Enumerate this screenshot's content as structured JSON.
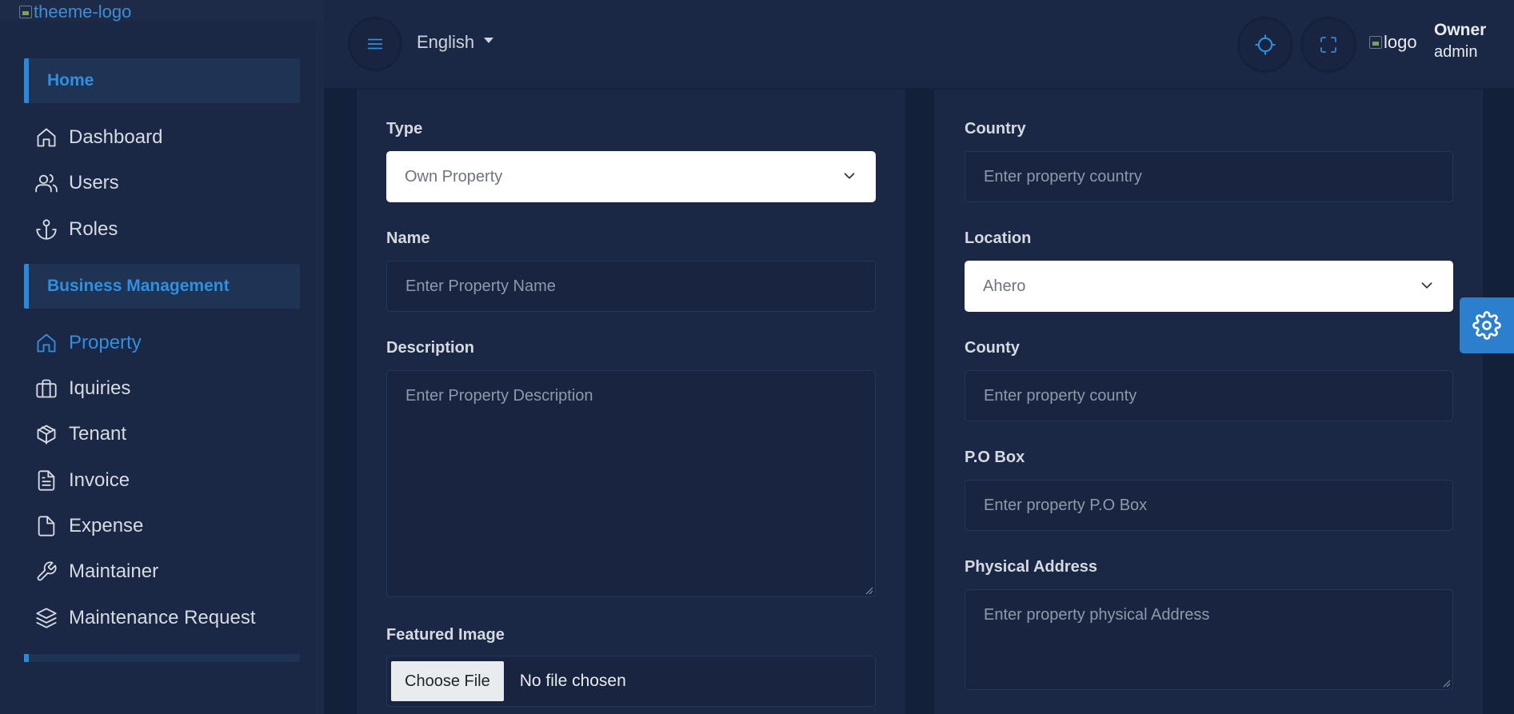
{
  "app": {
    "logo_alt": "theeme-logo"
  },
  "sidebar": {
    "sections": [
      {
        "label": "Home"
      },
      {
        "label": "Business Management"
      }
    ],
    "home_items": [
      {
        "label": "Dashboard",
        "icon": "home-icon"
      },
      {
        "label": "Users",
        "icon": "users-icon"
      },
      {
        "label": "Roles",
        "icon": "anchor-icon"
      }
    ],
    "business_items": [
      {
        "label": "Property",
        "icon": "home-icon",
        "active": true
      },
      {
        "label": "Iquiries",
        "icon": "briefcase-icon"
      },
      {
        "label": "Tenant",
        "icon": "package-icon"
      },
      {
        "label": "Invoice",
        "icon": "file-text-icon"
      },
      {
        "label": "Expense",
        "icon": "file-icon"
      },
      {
        "label": "Maintainer",
        "icon": "tool-icon"
      },
      {
        "label": "Maintenance Request",
        "icon": "layers-icon"
      }
    ]
  },
  "topbar": {
    "language": "English",
    "avatar_alt": "logo",
    "user_name": "Owner",
    "user_role": "admin"
  },
  "form": {
    "type": {
      "label": "Type",
      "value": "Own Property"
    },
    "name": {
      "label": "Name",
      "placeholder": "Enter Property Name"
    },
    "description": {
      "label": "Description",
      "placeholder": "Enter Property Description"
    },
    "featured_image": {
      "label": "Featured Image",
      "button": "Choose File",
      "status": "No file chosen"
    },
    "country": {
      "label": "Country",
      "placeholder": "Enter property country"
    },
    "location": {
      "label": "Location",
      "value": "Ahero"
    },
    "county": {
      "label": "County",
      "placeholder": "Enter property county"
    },
    "po_box": {
      "label": "P.O Box",
      "placeholder": "Enter property P.O Box"
    },
    "physical_address": {
      "label": "Physical Address",
      "placeholder": "Enter property physical Address"
    }
  },
  "colors": {
    "accent": "#2f8fe0",
    "background": "#13203a",
    "panel": "#1a2745"
  }
}
